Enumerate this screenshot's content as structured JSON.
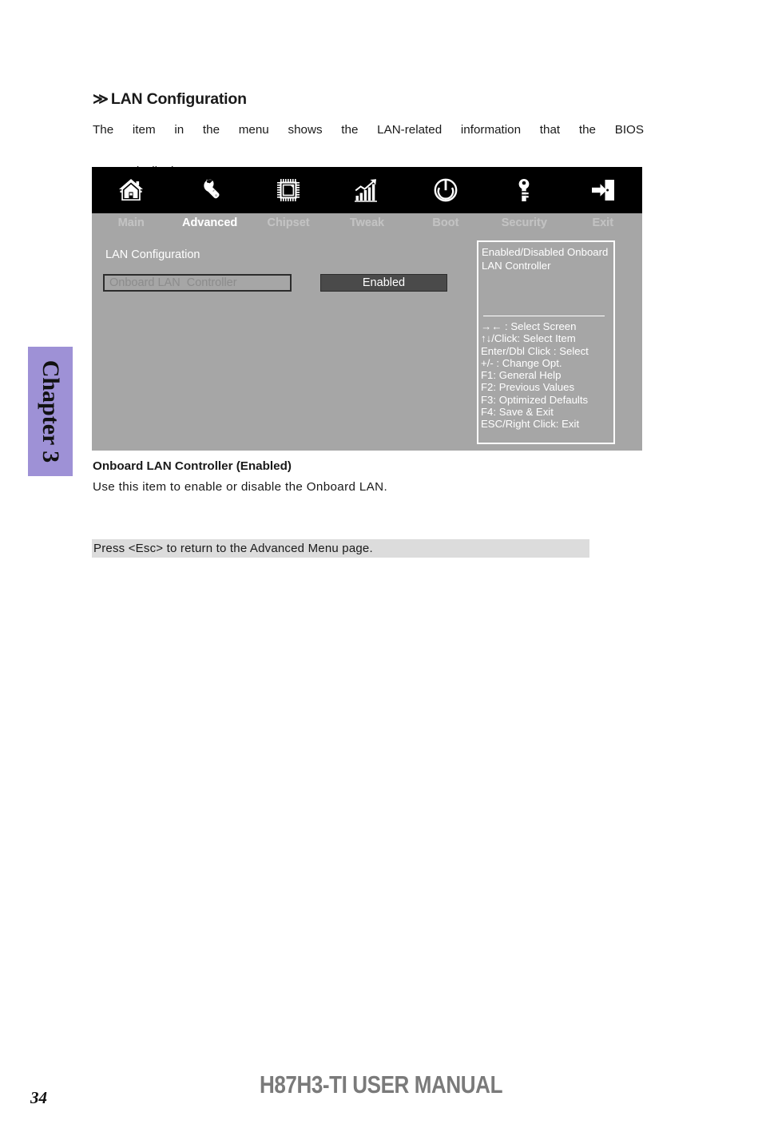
{
  "page": {
    "section_marker": "≫",
    "section_heading": "LAN Configuration",
    "intro_line1": "The item in the menu shows the LAN-related information that the BIOS",
    "intro_line2": "automatically detects.",
    "desc_title": "Onboard LAN Controller (Enabled)",
    "desc_text": "Use this item to enable or disable the Onboard LAN.",
    "esc_note": "Press <Esc> to return to the Advanced Menu page.",
    "chapter_tab": "Chapter 3",
    "footer_manual": "H87H3-TI USER MANUAL",
    "footer_page": "34"
  },
  "bios": {
    "nav": [
      {
        "label": "Main",
        "icon": "home-icon",
        "active": false
      },
      {
        "label": "Advanced",
        "icon": "wrench-icon",
        "active": true
      },
      {
        "label": "Chipset",
        "icon": "chip-icon",
        "active": false
      },
      {
        "label": "Tweak",
        "icon": "bar-chart-icon",
        "active": false
      },
      {
        "label": "Boot",
        "icon": "power-icon",
        "active": false
      },
      {
        "label": "Security",
        "icon": "key-icon",
        "active": false
      },
      {
        "label": "Exit",
        "icon": "exit-door-icon",
        "active": false
      }
    ],
    "section_title": "LAN Configuration",
    "setting": {
      "name": "Onboard LAN  Controller",
      "value": "Enabled"
    },
    "help": {
      "description": "Enabled/Disabled Onboard LAN Controller",
      "keys": [
        "→←   : Select Screen",
        "↑↓/Click: Select Item",
        "Enter/Dbl Click : Select",
        "+/- : Change Opt.",
        "F1: General Help",
        "F2: Previous Values",
        "F3: Optimized Defaults",
        "F4: Save & Exit",
        "ESC/Right Click: Exit"
      ]
    },
    "colors": {
      "topbar": "#000000",
      "body": "#a6a6a6",
      "value_box": "#4a4a4a",
      "active_label": "#ffffff",
      "inactive_label": "#c2c2c2"
    }
  },
  "colors": {
    "chapter_tab": "#9e91d6",
    "esc_banner": "#dcdcdc",
    "footer_manual": "#7a7a7a"
  }
}
